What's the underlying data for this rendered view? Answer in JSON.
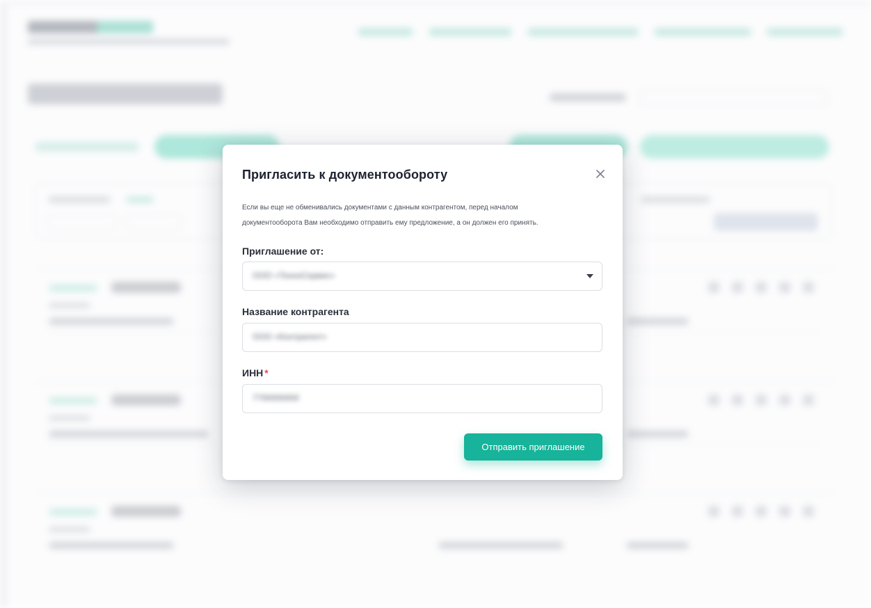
{
  "modal": {
    "title": "Пригласить к документообороту",
    "description_line1": "Если вы еще не обменивались документами с данным контрагентом, перед началом",
    "description_line2": "документооборота Вам необходимо отправить ему предложение, а он должен его принять.",
    "close_icon": "close-icon",
    "invitation_from": {
      "label": "Приглашение от:",
      "value": "ООО «ТехноСервис»"
    },
    "counterparty_name": {
      "label": "Название контрагента",
      "value": "ООО «Контрагент»"
    },
    "inn": {
      "label": "ИНН",
      "required_mark": "*",
      "value": "7700000000"
    },
    "submit_label": "Отправить приглашение"
  },
  "colors": {
    "accent": "#17b39a",
    "required": "#e5484d",
    "title": "#1d2230"
  }
}
